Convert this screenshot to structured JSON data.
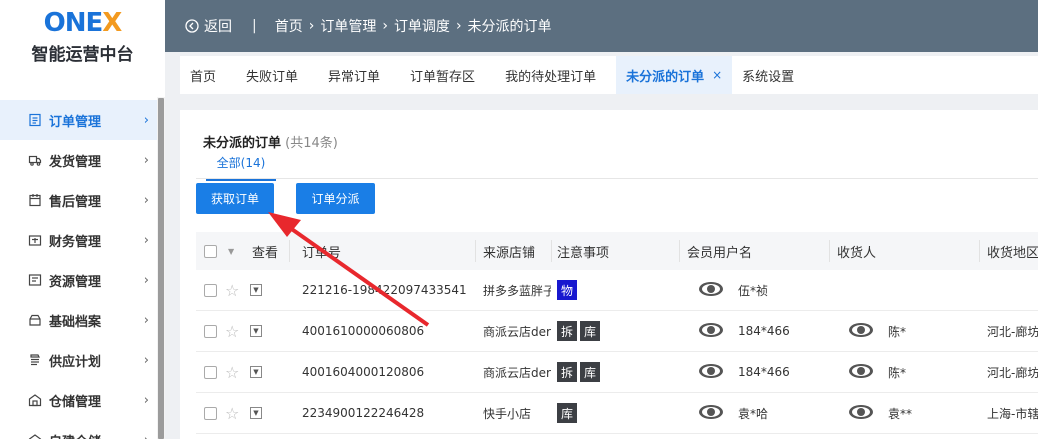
{
  "app": {
    "logo": "ONEX",
    "title": "智能运营中台"
  },
  "colors": {
    "primary": "#1a73d9",
    "header_bg": "#5c6f80",
    "logo_x": "#f39a1f",
    "tag_blue": "#1818cf",
    "tag_dark": "#3c3f44",
    "arrow": "#e8282d"
  },
  "sidebar": {
    "items": [
      {
        "label": "订单管理",
        "icon": "document-list-icon",
        "active": true
      },
      {
        "label": "发货管理",
        "icon": "truck-icon",
        "active": false
      },
      {
        "label": "售后管理",
        "icon": "calendar-icon",
        "active": false
      },
      {
        "label": "财务管理",
        "icon": "wallet-icon",
        "active": false
      },
      {
        "label": "资源管理",
        "icon": "resource-icon",
        "active": false
      },
      {
        "label": "基础档案",
        "icon": "archive-box-icon",
        "active": false
      },
      {
        "label": "供应计划",
        "icon": "supply-plan-icon",
        "active": false
      },
      {
        "label": "仓储管理",
        "icon": "warehouse-icon",
        "active": false
      },
      {
        "label": "自建仓储",
        "icon": "warehouse-icon",
        "active": false
      }
    ]
  },
  "header": {
    "back_label": "返回",
    "separator": "|",
    "breadcrumb": [
      "首页",
      "订单管理",
      "订单调度",
      "未分派的订单"
    ]
  },
  "tabs": [
    {
      "label": "首页",
      "active": false
    },
    {
      "label": "失败订单",
      "active": false
    },
    {
      "label": "异常订单",
      "active": false
    },
    {
      "label": "订单暂存区",
      "active": false
    },
    {
      "label": "我的待处理订单",
      "active": false
    },
    {
      "label": "未分派的订单",
      "active": true,
      "close": "×"
    },
    {
      "label": "系统设置",
      "active": false
    }
  ],
  "page": {
    "title": "未分派的订单",
    "count": "(共14条)",
    "subtab": "全部(14)",
    "buttons": {
      "fetch": "获取订单",
      "dispatch": "订单分派"
    }
  },
  "table": {
    "columns": {
      "view": "查看",
      "order_no": "订单号",
      "shop": "来源店铺",
      "notes": "注意事项",
      "member": "会员用户名",
      "receiver": "收货人",
      "region": "收货地区"
    },
    "rows": [
      {
        "order_no": "221216-198422097433541",
        "shop": "拼多多蓝胖子",
        "tags": [
          {
            "t": "物",
            "style": "blue"
          }
        ],
        "member": "伍*祯",
        "receiver": "",
        "region": ""
      },
      {
        "order_no": "4001610000060806",
        "shop": "商派云店der",
        "tags": [
          {
            "t": "拆",
            "style": "dark"
          },
          {
            "t": "库",
            "style": "dark"
          }
        ],
        "member": "184*466",
        "receiver": "陈*",
        "region": "河北-廊坊"
      },
      {
        "order_no": "4001604000120806",
        "shop": "商派云店der",
        "tags": [
          {
            "t": "拆",
            "style": "dark"
          },
          {
            "t": "库",
            "style": "dark"
          }
        ],
        "member": "184*466",
        "receiver": "陈*",
        "region": "河北-廊坊"
      },
      {
        "order_no": "2234900122246428",
        "shop": "快手小店",
        "tags": [
          {
            "t": "库",
            "style": "dark"
          }
        ],
        "member": "袁*哈",
        "receiver": "袁**",
        "region": "上海-市辖"
      }
    ]
  }
}
